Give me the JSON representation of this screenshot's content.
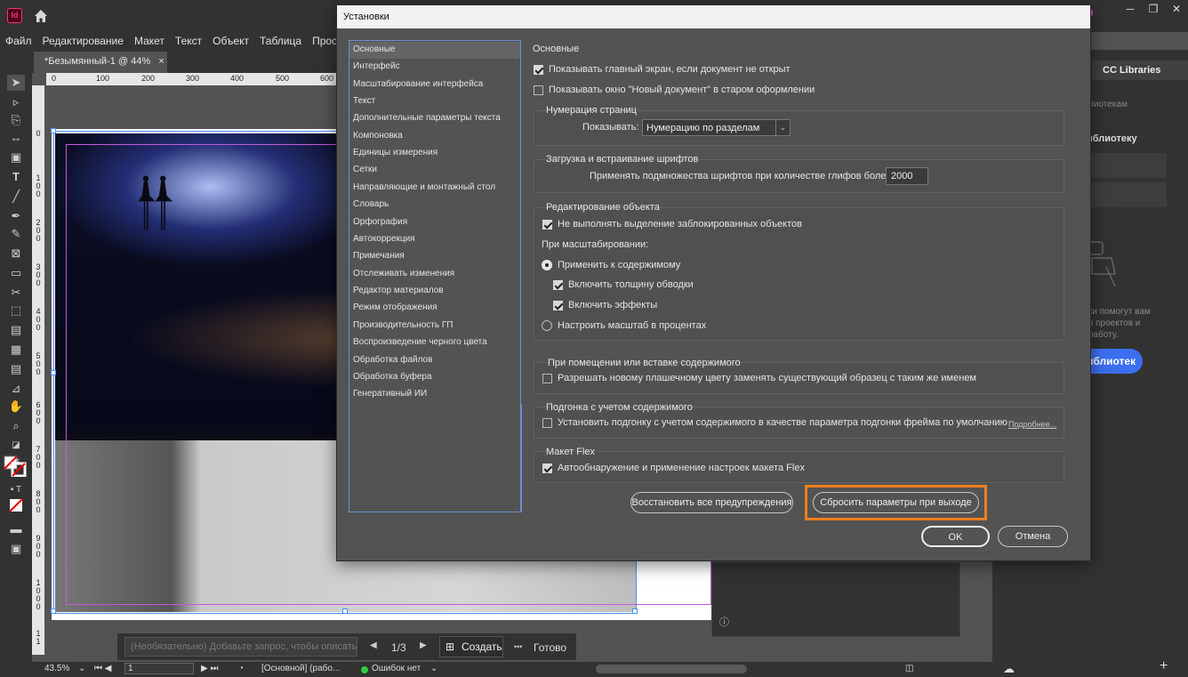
{
  "app": {
    "logo": "Id"
  },
  "menu": [
    "Файл",
    "Редактирование",
    "Макет",
    "Текст",
    "Объект",
    "Таблица",
    "Просмотр"
  ],
  "document": {
    "tab_title": "*Безымянный-1 @ 44%",
    "close": "×"
  },
  "ruler": {
    "top_ticks": [
      "0",
      "100",
      "200",
      "300",
      "400",
      "500",
      "600"
    ],
    "left_ticks": [
      "0",
      "1 0 0",
      "2 0 0",
      "3 0 0",
      "4 0 0",
      "5 0 0",
      "6 0 0",
      "7 0 0",
      "8 0 0",
      "9 0 0",
      "1 0 0 0",
      "1 1"
    ]
  },
  "dialog": {
    "title": "Установки",
    "nav": [
      "Основные",
      "Интерфейс",
      "Масштабирование интерфейса",
      "Текст",
      "Дополнительные параметры текста",
      "Компоновка",
      "Единицы измерения",
      "Сетки",
      "Направляющие и монтажный стол",
      "Словарь",
      "Орфография",
      "Автокоррекция",
      "Примечания",
      "Отслеживать изменения",
      "Редактор материалов",
      "Режим отображения",
      "Производительность ГП",
      "Воспроизведение черного цвета",
      "Обработка файлов",
      "Обработка буфера",
      "Генеративный ИИ"
    ],
    "section_title": "Основные",
    "show_home": "Показывать главный экран, если документ не открыт",
    "show_legacy_new_doc": "Показывать окно \"Новый документ\" в старом оформлении",
    "page_numbering": {
      "title": "Нумерация страниц",
      "show_label": "Показывать:",
      "value": "Нумерацию по разделам",
      "arrow": "⌄"
    },
    "font_download": {
      "title": "Загрузка и встраивание шрифтов",
      "label": "Применять подмножества шрифтов при количестве глифов более:",
      "value": "2000"
    },
    "object_editing": {
      "title": "Редактирование объекта",
      "no_select_locked": "Не выполнять выделение заблокированных объектов",
      "when_scaling": "При масштабировании:",
      "apply_to_content": "Применить к содержимому",
      "include_stroke": "Включить толщину обводки",
      "include_effects": "Включить эффекты",
      "adjust_percent": "Настроить масштаб в процентах"
    },
    "placing": {
      "title": "При помещении или вставке содержимого",
      "allow_replace": "Разрешать новому плашечному цвету заменять существующий образец с таким же именем"
    },
    "content_aware": {
      "title": "Подгонка с учетом содержимого",
      "set_default": "Установить подгонку с учетом содержимого в качестве параметра подгонки фрейма по умолчанию",
      "more": "Подробнее..."
    },
    "flex": {
      "title": "Макет Flex",
      "auto_detect": "Автообнаружение и применение настроек макета Flex"
    },
    "buttons": {
      "reset_warnings": "Восстановить все предупреждения",
      "reset_prefs": "Сбросить параметры при выходе",
      "ok": "OK",
      "cancel": "Отмена"
    },
    "highlight_color": "#f07d1e"
  },
  "cc_libraries": {
    "tab": "CC Libraries",
    "text1": "лиотекам",
    "text2": "иблиотеку",
    "desc1": "ки помогут вам",
    "desc2": "в проектов и",
    "desc3": "работу.",
    "button": "иблиотек"
  },
  "ai_bar": {
    "placeholder": "(Необязательно) Добавьте запрос, чтобы описать ",
    "page": "1/3",
    "create": "Создать",
    "more": "•••",
    "done": "Готово"
  },
  "status": {
    "zoom": "43.5%",
    "page": "1",
    "style": "[Основной] (рабо...",
    "errors": "Ошибок нет"
  }
}
